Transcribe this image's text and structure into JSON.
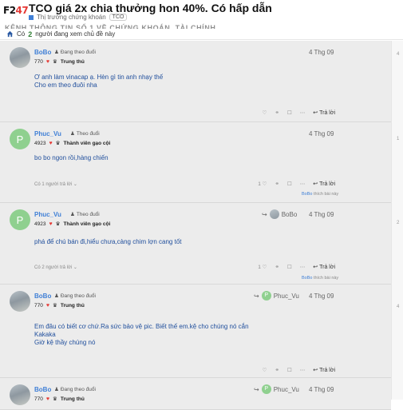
{
  "header": {
    "logo_prefix": "F2",
    "logo_suffix": "47",
    "title": "TCO giá 2x chia thưởng hon 40%. Có hấp dẫn",
    "category": "Thị trường chứng khoán",
    "tag": "TCO",
    "ghost_text": "KÊNH THÔNG TIN SỐ 1 VỀ CHỨNG KHOÁN, TÀI CHÍNH"
  },
  "notice": {
    "prefix": "Có",
    "count": "2",
    "suffix": "người đang xem chủ đề này"
  },
  "posts": [
    {
      "username": "BoBo",
      "follow_label": "Đang theo đuổi",
      "score": "770",
      "rank": "Trung thủ",
      "date": "4 Thg 09",
      "body_lines": [
        "Ơ anh làm vinacap ạ. Hèn gì tin anh nhạy thế",
        "Cho em theo đuôi nha"
      ],
      "like_count": "",
      "reply_label": "Trả lời",
      "replies_text": "",
      "liked_by": "",
      "liked_suffix": ""
    },
    {
      "username": "Phuc_Vu",
      "avatar_letter": "P",
      "follow_label": "Theo đuổi",
      "score": "4923",
      "rank": "Thành viên gạo cội",
      "date": "4 Thg 09",
      "body_lines": [
        "bo bo ngon rồi,hàng chiến"
      ],
      "like_count": "1",
      "reply_label": "Trả lời",
      "replies_text": "Có 1 người trả lời",
      "liked_by": "BoBo",
      "liked_suffix": "thích bài này"
    },
    {
      "username": "Phuc_Vu",
      "avatar_letter": "P",
      "follow_label": "Theo đuổi",
      "score": "4923",
      "rank": "Thành viên gạo cội",
      "date": "4 Thg 09",
      "reply_to": "BoBo",
      "body_lines": [
        "phá để chú bán đi,hiểu chưa,càng chim lợn cang tốt"
      ],
      "like_count": "1",
      "reply_label": "Trả lời",
      "replies_text": "Có 2 người trả lời",
      "liked_by": "BoBo",
      "liked_suffix": "thích bài này"
    },
    {
      "username": "BoBo",
      "follow_label": "Đang theo đuổi",
      "score": "770",
      "rank": "Trung thủ",
      "date": "4 Thg 09",
      "reply_to": "Phuc_Vu",
      "reply_to_letter": "P",
      "body_lines": [
        "Em đâu có biết cơ chứ.Ra sức bảo vệ pic. Biết thế em.kệ cho chúng nó cắn",
        "Kakaka",
        "Giờ kệ thầy chúng nó"
      ],
      "like_count": "",
      "reply_label": "Trả lời",
      "replies_text": "",
      "liked_by": "",
      "liked_suffix": ""
    },
    {
      "username": "BoBo",
      "follow_label": "Đang theo đuổi",
      "score": "770",
      "rank": "Trung thủ",
      "date": "4 Thg 09",
      "reply_to": "Phuc_Vu",
      "reply_to_letter": "P",
      "body_lines": [],
      "like_count": "",
      "reply_label": "",
      "replies_text": "",
      "liked_by": "",
      "liked_suffix": ""
    }
  ],
  "sidebar_marks": [
    "4",
    "1",
    "2",
    "4"
  ],
  "colors": {
    "accent": "#3f7fd6",
    "heart": "#e53935",
    "post_bg": "#ececec",
    "avatar_letter_bg": "#8fd08f"
  }
}
